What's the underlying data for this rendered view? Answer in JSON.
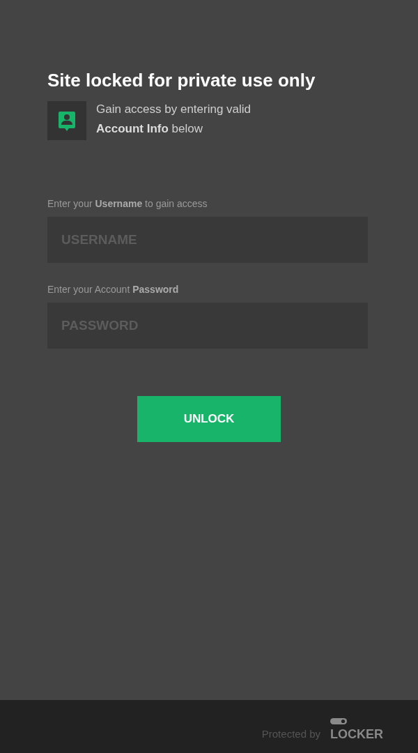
{
  "title": "Site locked for private use only",
  "notice": {
    "text": "Gain access by entering valid\n**Account Info** below"
  },
  "fields": [
    {
      "label": "Enter your **Username** to gain access",
      "placeholder": "USERNAME"
    },
    {
      "label": "Enter your Account **Password**",
      "placeholder": "PASSWORD"
    }
  ],
  "button": {
    "label": "UNLOCK"
  },
  "footer": {
    "text": "Protected by",
    "brand": "LOCKER"
  }
}
